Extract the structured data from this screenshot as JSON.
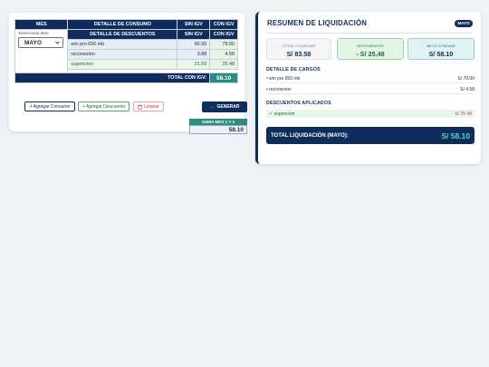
{
  "left": {
    "headers": {
      "mes": "MES",
      "detalle_consumo": "DETALLE DE CONSUMO",
      "sin_igv": "SIN IGV",
      "con_igv": "CON IGV"
    },
    "subheaders": {
      "detalle_descuentos": "DETALLE DE DESCUENTOS",
      "sin_igv": "SIN IGV",
      "con_igv": "CON IGV"
    },
    "month_label": "Seleccionar Mes:",
    "month_value": "MAYO",
    "rows": [
      {
        "detalle": "win pro 650 mb",
        "sin_igv": "66.95",
        "con_igv": "79.00"
      },
      {
        "detalle": "reconexion",
        "sin_igv": "3.88",
        "con_igv": "4.58"
      },
      {
        "detalle": "supencion",
        "sin_igv": "21.59",
        "con_igv": "25.48"
      }
    ],
    "total_label": "TOTAL CON IGV:",
    "total_value": "58.10",
    "buttons": {
      "agregar_consumo": "+ Agregar Consumo",
      "agregar_descuento": "+ Agregar Descuento",
      "limpiar": "Limpiar",
      "generar": "GENERAR"
    },
    "suma_label": "SUMA MES 1 Y 2",
    "suma_value": "58.10"
  },
  "right": {
    "title": "RESUMEN DE LIQUIDACIÓN",
    "badge": "MAYO",
    "cards": [
      {
        "label": "TOTAL CONSUMO",
        "value": "S/ 83.58"
      },
      {
        "label": "DESCUENTOS",
        "value": "- S/ 25.48"
      },
      {
        "label": "NETO A PAGAR",
        "value": "S/ 58.10"
      }
    ],
    "cargos_title": "DETALLE DE CARGOS",
    "cargos": [
      {
        "name": "• win pro 650 mb",
        "value": "S/ 79.00"
      },
      {
        "name": "• reconexion",
        "value": "S/ 4.58"
      }
    ],
    "descuentos_title": "DESCUENTOS APLICADOS",
    "descuentos": [
      {
        "name": "✓ supencion",
        "value": "- S/ 25.48"
      }
    ],
    "total_label": "TOTAL LIQUIDACIÓN (MAYO):",
    "total_value": "S/ 58.10"
  },
  "colors": {
    "navy": "#0f2d5c",
    "teal": "#2a8c83",
    "green": "#1d6b34",
    "red": "#c53030"
  }
}
